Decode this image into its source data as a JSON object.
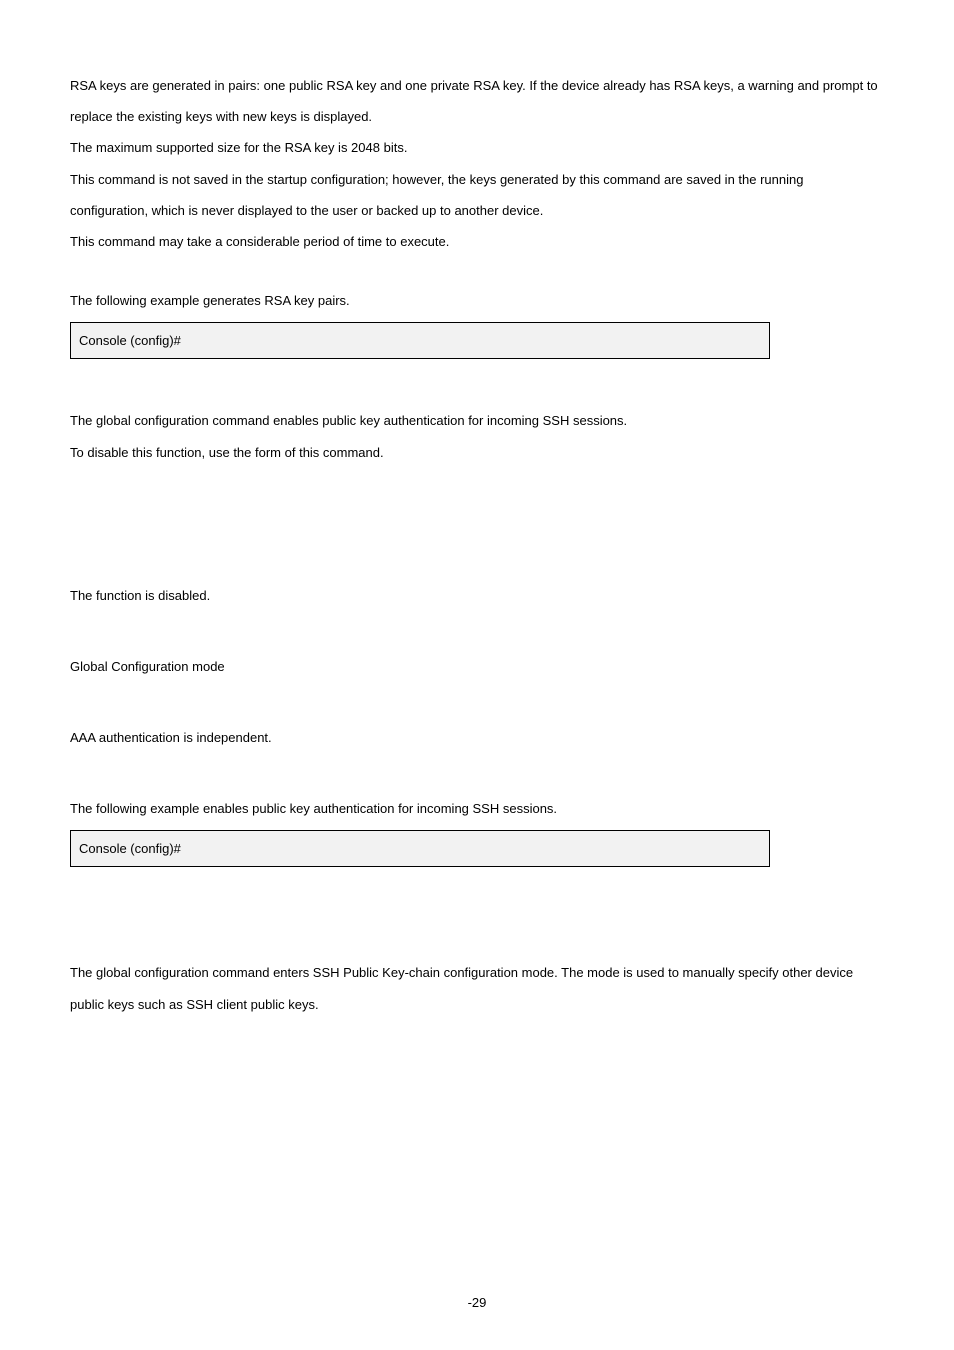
{
  "para1": "RSA keys are generated in pairs: one public RSA key and one private RSA key. If the device already has RSA keys, a warning and prompt to replace the existing keys with new keys is displayed.",
  "para2": "The maximum supported size for the RSA key is 2048 bits.",
  "para3": "This command is not saved in the startup configuration; however, the keys generated by this command are saved in the running configuration, which is never displayed to the user or backed up to another device.",
  "para4": "This command may take a considerable period of time to execute.",
  "example1_intro": "The following example generates RSA key pairs.",
  "console1_prefix": "Console (config)# ",
  "console1_cmd": "",
  "ip_ssh_the": "The ",
  "ip_ssh_cmd": "",
  "ip_ssh_rest": " global configuration command enables public key authentication for incoming SSH sessions.",
  "ip_ssh_disable_pre": "To disable this function, use the ",
  "ip_ssh_disable_no": "",
  "ip_ssh_disable_post": " form of this command.",
  "default_text": "The function is disabled.",
  "mode_text": "Global Configuration mode",
  "guideline_text": "AAA authentication is independent.",
  "example2_intro": "The following example enables public key authentication for incoming SSH sessions.",
  "console2_prefix": "Console (config)# ",
  "console2_cmd": "",
  "crypto_the": "The ",
  "crypto_cmd": "",
  "crypto_rest": " global configuration command enters SSH Public Key-chain configuration mode. The mode is used to manually specify other device public keys such as SSH client public keys.",
  "page_num": "-29"
}
